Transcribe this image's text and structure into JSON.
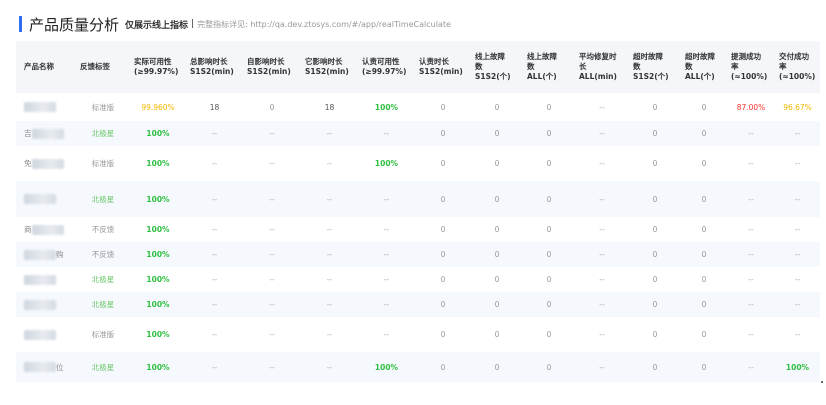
{
  "header": {
    "title": "产品质量分析",
    "subtitle": "仅展示线上指标",
    "separator": "|",
    "desc": "完整指标详见: http://qa.dev.ztosys.com/#/app/realTimeCalculate"
  },
  "columns": [
    "产品名称",
    "反馈标签",
    "实际可用性\n(≥99.97%)",
    "总影响时长\nS1S2(min)",
    "自影响时长\nS1S2(min)",
    "它影响时长\nS1S2(min)",
    "认责可用性\n(≥99.97%)",
    "认责时长\nS1S2(min)",
    "线上故障\n数\nS1S2(个)",
    "线上故障\n数\nALL(个)",
    "平均修复时\n长\nALL(min)",
    "超时故障\n数\nS1S2(个)",
    "超时故障\n数\nALL(个)",
    "提测成功\n率\n(≈100%)",
    "交付成功\n率\n(≈100%)"
  ],
  "rows": [
    {
      "name_prefix": "",
      "name_suffix": "",
      "tag": "标准版",
      "avail": "99.960%",
      "total": "18",
      "self": "0",
      "other": "18",
      "resp_avail": "100%",
      "resp_time": "0",
      "online_s": "0",
      "online_all": "0",
      "avg_fix": "--",
      "timeout_s": "0",
      "timeout_all": "0",
      "test_rate": "87.00%",
      "deliver_rate": "96.67%"
    },
    {
      "name_prefix": "吉",
      "name_suffix": "",
      "tag": "北极星",
      "avail": "100%",
      "total": "--",
      "self": "--",
      "other": "--",
      "resp_avail": "--",
      "resp_time": "0",
      "online_s": "0",
      "online_all": "0",
      "avg_fix": "--",
      "timeout_s": "0",
      "timeout_all": "0",
      "test_rate": "--",
      "deliver_rate": "--"
    },
    {
      "name_prefix": "免",
      "name_suffix": "",
      "tag": "标准版",
      "avail": "100%",
      "total": "--",
      "self": "--",
      "other": "--",
      "resp_avail": "100%",
      "resp_time": "0",
      "online_s": "0",
      "online_all": "0",
      "avg_fix": "--",
      "timeout_s": "0",
      "timeout_all": "0",
      "test_rate": "--",
      "deliver_rate": "--"
    },
    {
      "name_prefix": "",
      "name_suffix": "",
      "tag": "北极星",
      "avail": "100%",
      "total": "--",
      "self": "--",
      "other": "--",
      "resp_avail": "--",
      "resp_time": "0",
      "online_s": "0",
      "online_all": "0",
      "avg_fix": "--",
      "timeout_s": "0",
      "timeout_all": "0",
      "test_rate": "--",
      "deliver_rate": "--"
    },
    {
      "name_prefix": "商",
      "name_suffix": "",
      "tag": "不反馈",
      "avail": "100%",
      "total": "--",
      "self": "--",
      "other": "--",
      "resp_avail": "--",
      "resp_time": "0",
      "online_s": "0",
      "online_all": "0",
      "avg_fix": "--",
      "timeout_s": "0",
      "timeout_all": "0",
      "test_rate": "--",
      "deliver_rate": "--"
    },
    {
      "name_prefix": "",
      "name_suffix": "购",
      "tag": "不反馈",
      "avail": "100%",
      "total": "--",
      "self": "--",
      "other": "--",
      "resp_avail": "--",
      "resp_time": "0",
      "online_s": "0",
      "online_all": "0",
      "avg_fix": "--",
      "timeout_s": "0",
      "timeout_all": "0",
      "test_rate": "--",
      "deliver_rate": "--"
    },
    {
      "name_prefix": "",
      "name_suffix": "",
      "tag": "北极星",
      "avail": "100%",
      "total": "--",
      "self": "--",
      "other": "--",
      "resp_avail": "--",
      "resp_time": "0",
      "online_s": "0",
      "online_all": "0",
      "avg_fix": "--",
      "timeout_s": "0",
      "timeout_all": "0",
      "test_rate": "--",
      "deliver_rate": "--"
    },
    {
      "name_prefix": "",
      "name_suffix": "",
      "tag": "北极星",
      "avail": "100%",
      "total": "--",
      "self": "--",
      "other": "--",
      "resp_avail": "--",
      "resp_time": "0",
      "online_s": "0",
      "online_all": "0",
      "avg_fix": "--",
      "timeout_s": "0",
      "timeout_all": "0",
      "test_rate": "--",
      "deliver_rate": "--"
    },
    {
      "name_prefix": "",
      "name_suffix": "",
      "tag": "标准版",
      "avail": "100%",
      "total": "--",
      "self": "--",
      "other": "--",
      "resp_avail": "--",
      "resp_time": "0",
      "online_s": "0",
      "online_all": "0",
      "avg_fix": "--",
      "timeout_s": "0",
      "timeout_all": "0",
      "test_rate": "--",
      "deliver_rate": "--"
    },
    {
      "name_prefix": "",
      "name_suffix": "位",
      "tag": "北极星",
      "avail": "100%",
      "total": "--",
      "self": "--",
      "other": "--",
      "resp_avail": "100%",
      "resp_time": "0",
      "online_s": "0",
      "online_all": "0",
      "avg_fix": "--",
      "timeout_s": "0",
      "timeout_all": "0",
      "test_rate": "--",
      "deliver_rate": "100%"
    }
  ],
  "colors": {
    "accent": "#2f6df5",
    "green": "#2fbf42",
    "tag_green": "#6cc86a",
    "orange": "#f5b800",
    "red": "#f5322c"
  }
}
